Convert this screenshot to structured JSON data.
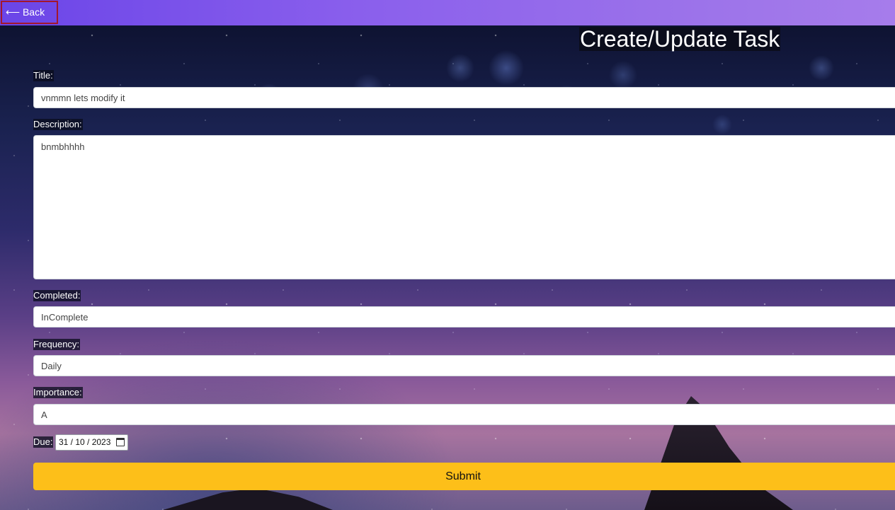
{
  "nav": {
    "back_label": "⟵ Back"
  },
  "page": {
    "title": "Create/Update Task"
  },
  "form": {
    "title_label": "Title:",
    "title_value": "vnmmn lets modify it",
    "description_label": "Description:",
    "description_value": "bnmbhhhh",
    "completed_label": "Completed:",
    "completed_value": "InComplete",
    "frequency_label": "Frequency:",
    "frequency_value": "Daily",
    "importance_label": "Importance:",
    "importance_value": "A",
    "due_label": "Due:",
    "due_value": "31 / 10 / 2023",
    "submit_label": "Submit"
  },
  "icons": {
    "calendar": "calendar-icon",
    "back_arrow": "arrow-left"
  },
  "colors": {
    "topbar_start": "#6b45e8",
    "topbar_end": "#a67ceb",
    "submit_bg": "#fdbf19",
    "back_border": "#a3172c"
  }
}
